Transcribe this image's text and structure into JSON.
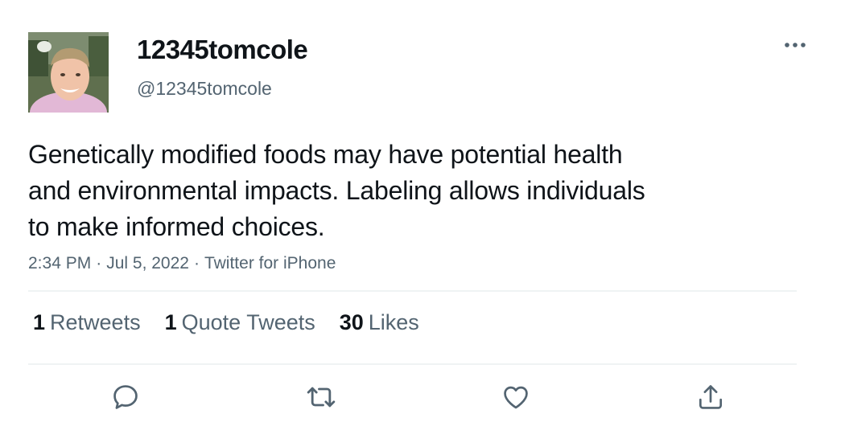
{
  "tweet": {
    "author": {
      "display_name": "12345tomcole",
      "handle": "@12345tomcole",
      "avatar": "profile-photo"
    },
    "text_lines": [
      "Genetically modified foods may have potential health",
      "and environmental impacts. Labeling allows individuals",
      "to make informed choices."
    ],
    "time": "2:34 PM",
    "separator": "·",
    "date": "Jul 5, 2022",
    "source": "Twitter for iPhone",
    "stats": {
      "retweets": {
        "count": "1",
        "label": "Retweets"
      },
      "quote_tweets": {
        "count": "1",
        "label": "Quote Tweets"
      },
      "likes": {
        "count": "30",
        "label": "Likes"
      }
    },
    "actions": [
      "reply-icon",
      "retweet-icon",
      "like-icon",
      "share-icon"
    ],
    "more_icon": "more-options-icon"
  },
  "colors": {
    "text_primary": "#0f1419",
    "text_secondary": "#536471",
    "divider": "#eff3f4",
    "background": "#ffffff"
  }
}
